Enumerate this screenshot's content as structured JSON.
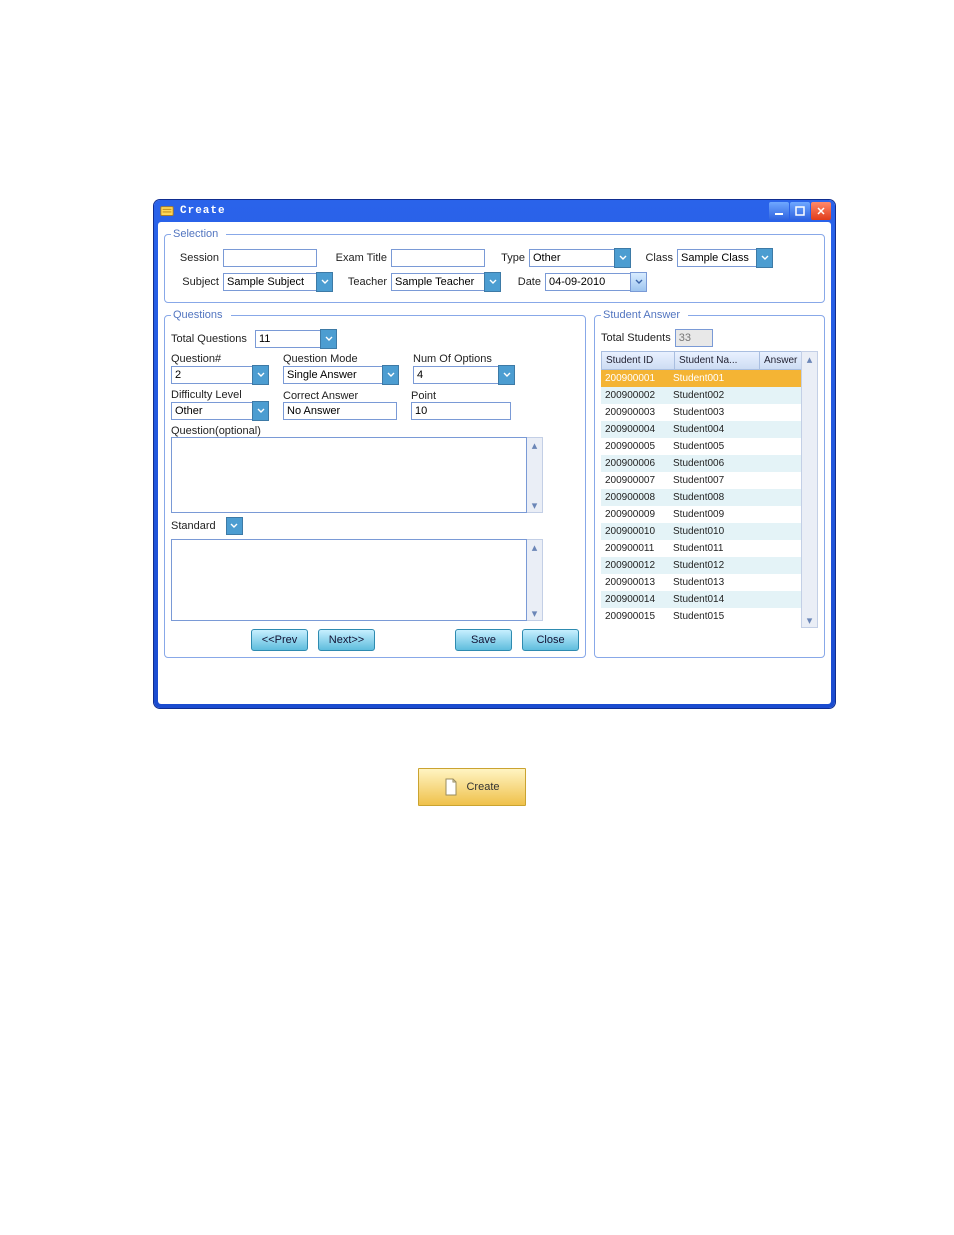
{
  "window": {
    "title": "Create"
  },
  "selection": {
    "legend": "Selection",
    "session_label": "Session",
    "session_value": "",
    "exam_title_label": "Exam Title",
    "exam_title_value": "",
    "type_label": "Type",
    "type_value": "Other",
    "class_label": "Class",
    "class_value": "Sample Class",
    "subject_label": "Subject",
    "subject_value": "Sample Subject",
    "teacher_label": "Teacher",
    "teacher_value": "Sample Teacher",
    "date_label": "Date",
    "date_value": "04-09-2010"
  },
  "questions": {
    "legend": "Questions",
    "total_label": "Total Questions",
    "total_value": "11",
    "qnum_label": "Question#",
    "qnum_value": "2",
    "mode_label": "Question Mode",
    "mode_value": "Single Answer",
    "numopt_label": "Num Of Options",
    "numopt_value": "4",
    "diff_label": "Difficulty Level",
    "diff_value": "Other",
    "correct_label": "Correct Answer",
    "correct_value": "No Answer",
    "point_label": "Point",
    "point_value": "10",
    "qtext_label": "Question(optional)",
    "qtext_value": "",
    "standard_label": "Standard",
    "standard_value": ""
  },
  "answers": {
    "legend": "Student Answer",
    "total_label": "Total Students",
    "total_value": "33",
    "headers": {
      "id": "Student ID",
      "name": "Student Na...",
      "ans": "Answer"
    },
    "rows": [
      {
        "id": "200900001",
        "name": "Student001",
        "ans": ""
      },
      {
        "id": "200900002",
        "name": "Student002",
        "ans": ""
      },
      {
        "id": "200900003",
        "name": "Student003",
        "ans": ""
      },
      {
        "id": "200900004",
        "name": "Student004",
        "ans": ""
      },
      {
        "id": "200900005",
        "name": "Student005",
        "ans": ""
      },
      {
        "id": "200900006",
        "name": "Student006",
        "ans": ""
      },
      {
        "id": "200900007",
        "name": "Student007",
        "ans": ""
      },
      {
        "id": "200900008",
        "name": "Student008",
        "ans": ""
      },
      {
        "id": "200900009",
        "name": "Student009",
        "ans": ""
      },
      {
        "id": "200900010",
        "name": "Student010",
        "ans": ""
      },
      {
        "id": "200900011",
        "name": "Student011",
        "ans": ""
      },
      {
        "id": "200900012",
        "name": "Student012",
        "ans": ""
      },
      {
        "id": "200900013",
        "name": "Student013",
        "ans": ""
      },
      {
        "id": "200900014",
        "name": "Student014",
        "ans": ""
      },
      {
        "id": "200900015",
        "name": "Student015",
        "ans": ""
      }
    ]
  },
  "buttons": {
    "prev": "<<Prev",
    "next": "Next>>",
    "save": "Save",
    "close": "Close"
  },
  "create_label": "Create"
}
